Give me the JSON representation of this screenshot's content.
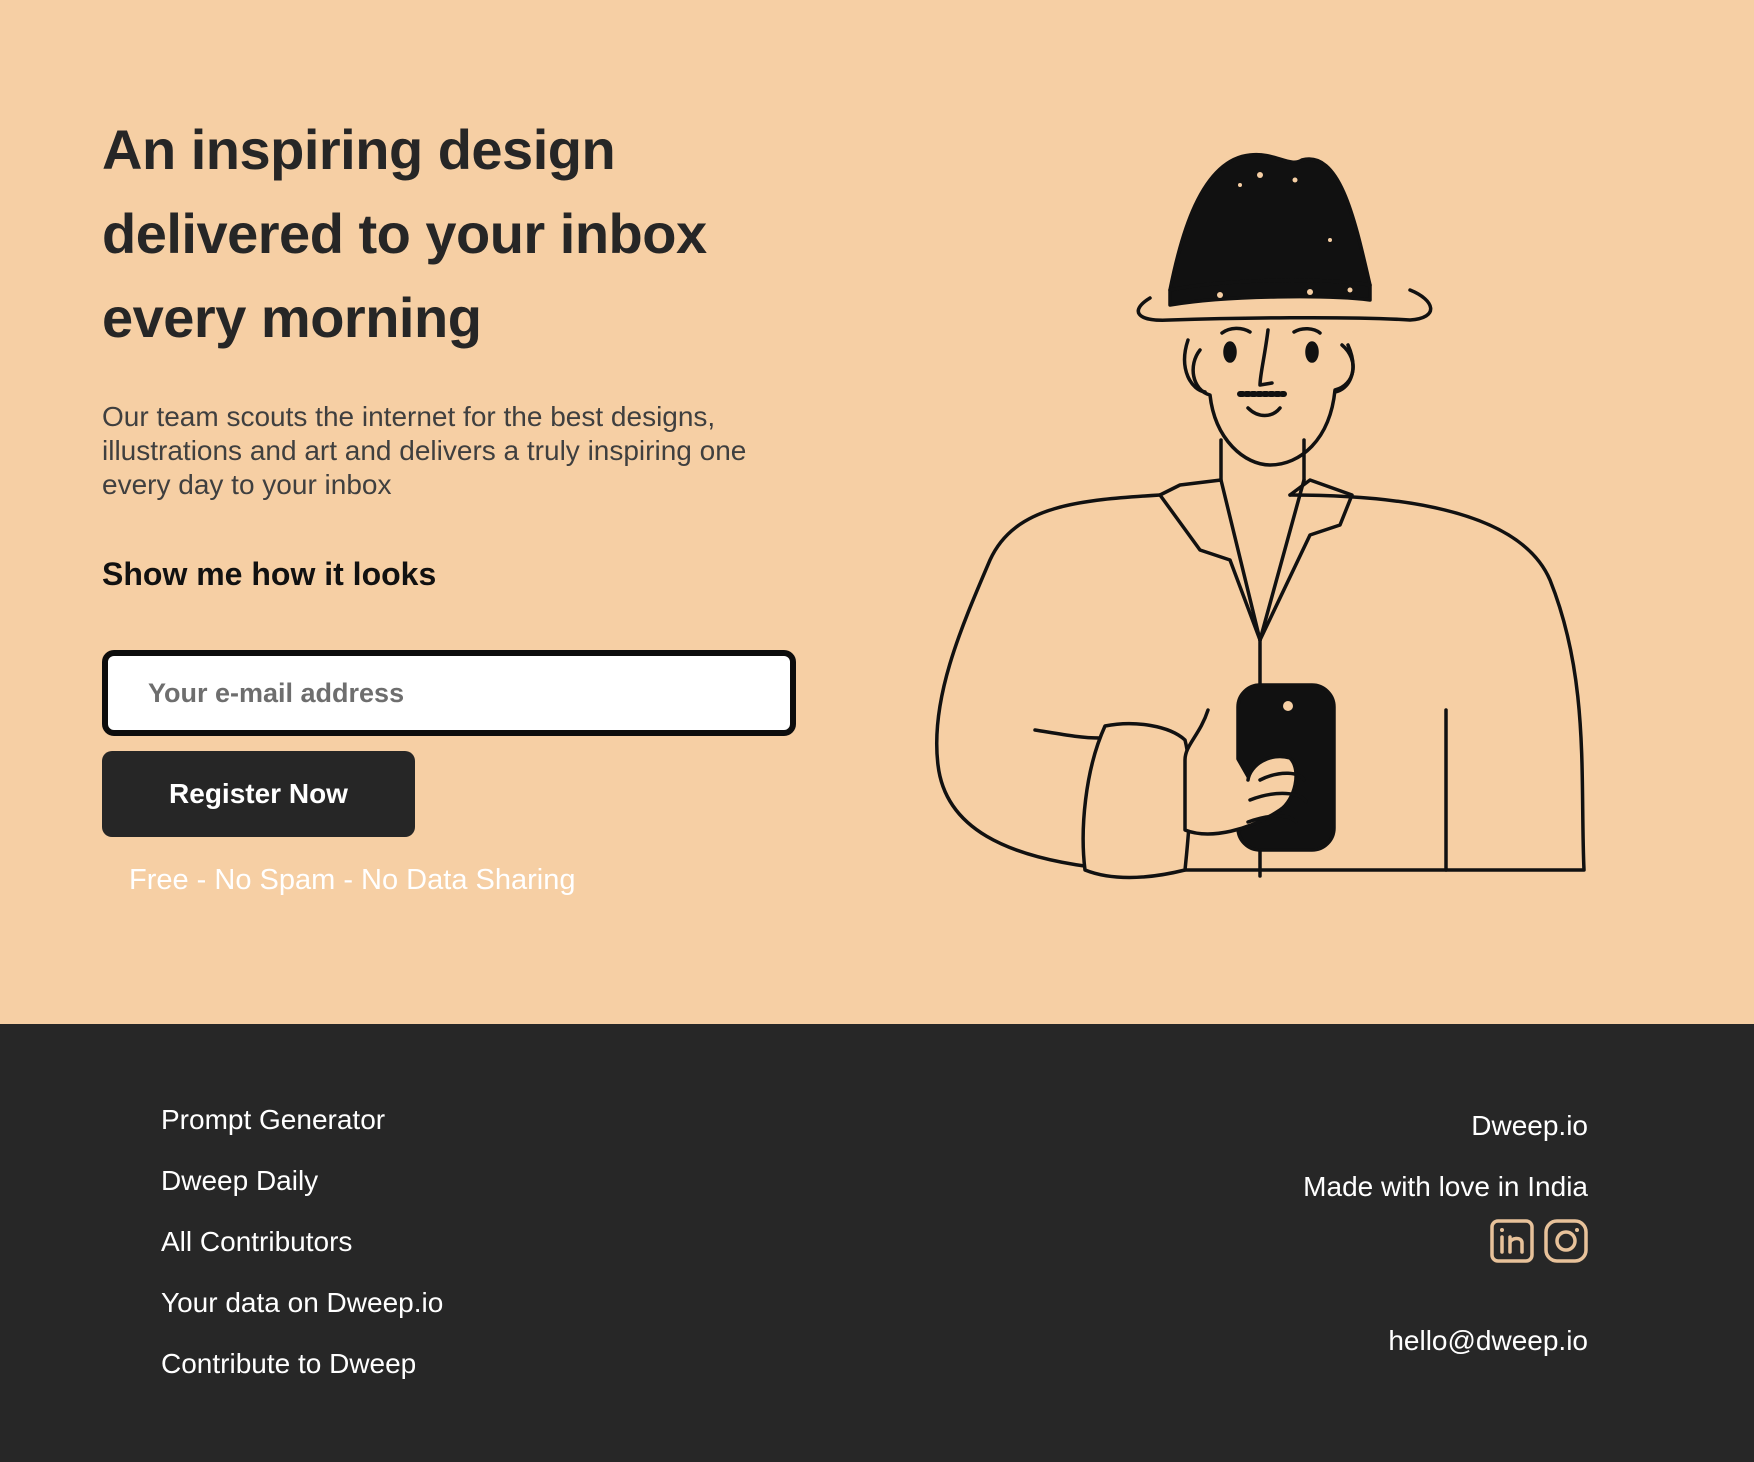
{
  "hero": {
    "headline": "An inspiring design delivered to your inbox every morning",
    "subtext": "Our team scouts the internet for the best designs, illustrations and art and delivers a truly inspiring one every day to your inbox",
    "show_me_link": "Show me how it looks",
    "email_placeholder": "Your e-mail address",
    "register_button": "Register Now",
    "free_note": "Free - No Spam - No Data Sharing",
    "illustration_icon": "man-with-hat-holding-phone-illustration"
  },
  "footer": {
    "links": [
      "Prompt Generator",
      "Dweep Daily",
      "All Contributors",
      "Your data on Dweep.io",
      "Contribute to Dweep"
    ],
    "brand": "Dweep.io",
    "made_with": "Made with love in India",
    "socials": [
      "linkedin-icon",
      "instagram-icon"
    ],
    "email": "hello@dweep.io"
  },
  "colors": {
    "hero_background": "#f6cfa4",
    "footer_background": "#272727",
    "button_background": "#262626",
    "icon_accent": "#e8c29a"
  }
}
